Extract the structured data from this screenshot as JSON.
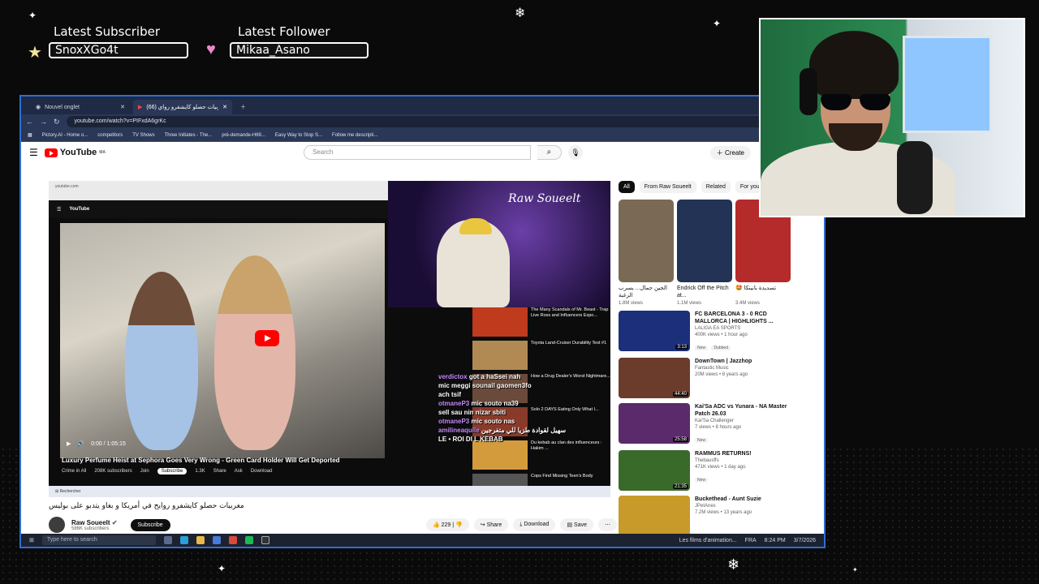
{
  "overlay": {
    "latest_subscriber_label": "Latest Subscriber",
    "latest_subscriber_value": "SnoxXGo4t",
    "latest_follower_label": "Latest Follower",
    "latest_follower_value": "Mikaa_Asano"
  },
  "browser": {
    "tabs": [
      {
        "label": "Nouvel onglet"
      },
      {
        "label": "(66) مغربيات حصلو كايشفرو رواي..."
      }
    ],
    "url": "youtube.com/watch?v=PIFxdA6grKc",
    "bookmarks": [
      "Pictory.AI - Home o...",
      "competitors",
      "TV Shows",
      "Three Initiates - The...",
      "pré-demande-H69...",
      "Easy Way to Stop S...",
      "Follow me descripti..."
    ]
  },
  "youtube": {
    "logo": "YouTube",
    "region": "MA",
    "search_placeholder": "Search",
    "create_label": "Create"
  },
  "player": {
    "inner_title": "Luxury Perfume Heist at Sephora Goes Very Wrong - Green Card Holder Will Get Deported",
    "inner_channel": "Crime in All",
    "inner_subs": "208K subscribers",
    "inner_join": "Join",
    "inner_subscribe": "Subscribe",
    "time": "0:00 / 1:05:15",
    "inner_likes": "1.3K",
    "inner_share": "Share",
    "inner_ask": "Ask",
    "inner_download": "Download",
    "facecam_brand": "Raw Soueelt",
    "recs": [
      {
        "title": "The Many Scandals of Mr. Beast - Trap Live Ross and Influencers Expo..."
      },
      {
        "title": "Toyota Land-Cruiser Durability Test #1"
      },
      {
        "title": "How a Drug Dealer's Worst Nightmare..."
      },
      {
        "title": "Solo 2 DAYS Eating Only What I..."
      },
      {
        "title": "Du kebab au clan des influenceurs : Hakim ..."
      },
      {
        "title": "Cops Find Missing Teen's Body"
      }
    ],
    "chat": [
      {
        "user": "verdictox",
        "msg": "got a haSsei nah"
      },
      {
        "user": "",
        "msg": "mic meggi sounail gaomen3fo"
      },
      {
        "user": "",
        "msg": "ach tsif"
      },
      {
        "user": "otmaneP3",
        "msg": "mic souto na39"
      },
      {
        "user": "",
        "msg": "sell sau nin nizar sbiti"
      },
      {
        "user": "otmaneP3",
        "msg": "mic souto nas"
      },
      {
        "user": "amilineaquile",
        "msg": "سهيل لقوادة طزيا للي متفرجين"
      },
      {
        "user": "",
        "msg": "LE • ROI DI L KEBAB"
      }
    ]
  },
  "video": {
    "title": "مغربيات حصلو كايشفرو روايح في أمريكا و بغاو يتدبو على بوليس",
    "channel": "Raw Soueelt",
    "subs": "586K subscribers",
    "subscribe": "Subscribe",
    "likes": "229",
    "share": "Share",
    "download": "Download",
    "save": "Save"
  },
  "sidebar": {
    "chips": [
      "All",
      "From Raw Soueelt",
      "Related",
      "For you"
    ],
    "shorts": [
      {
        "title": "الجين جمال... يسرب الرغبة",
        "views": "1.8M views",
        "color": "#7a6a55"
      },
      {
        "title": "Endrick Off the Pitch at...",
        "views": "1.1M views",
        "color": "#223355"
      },
      {
        "title": "🤩 تسديدة بانينكا",
        "views": "3.4M views",
        "color": "#b52a2a"
      }
    ],
    "videos": [
      {
        "title": "FC BARCELONA 3 - 0 RCD MALLORCA | HIGHLIGHTS ...",
        "channel": "LALIGA EA SPORTS",
        "meta": "400K views • 1 hour ago",
        "badge": "New",
        "badge2": "Dubbed",
        "duration": "3:13",
        "color": "#1c2f7a"
      },
      {
        "title": "DownTown | Jazzhop",
        "channel": "Fantastic Music",
        "meta": "20M views • 8 years ago",
        "badge": "",
        "badge2": "",
        "duration": "44:40",
        "color": "#6b3c2b"
      },
      {
        "title": "Kai'Sa ADC vs Yunara - NA Master Patch 26.03",
        "channel": "Kai'Sa Challenger",
        "meta": "7 views • 8 hours ago",
        "badge": "New",
        "badge2": "",
        "duration": "25:58",
        "color": "#5a2a6a"
      },
      {
        "title": "RAMMUS RETURNS!",
        "channel": "Thebausffs",
        "meta": "471K views • 1 day ago",
        "badge": "New",
        "badge2": "",
        "duration": "21:35",
        "color": "#3a6a2a"
      },
      {
        "title": "Buckethead - Aunt Suzie",
        "channel": "JPetAnes",
        "meta": "7.2M views • 13 years ago",
        "badge": "",
        "badge2": "",
        "duration": "",
        "color": "#c79a2a"
      }
    ]
  },
  "taskbar": {
    "search": "Type here to search",
    "notification": "Les films d'animation...",
    "lang": "FRA",
    "time": "8:24 PM",
    "date": "3/7/2026"
  }
}
